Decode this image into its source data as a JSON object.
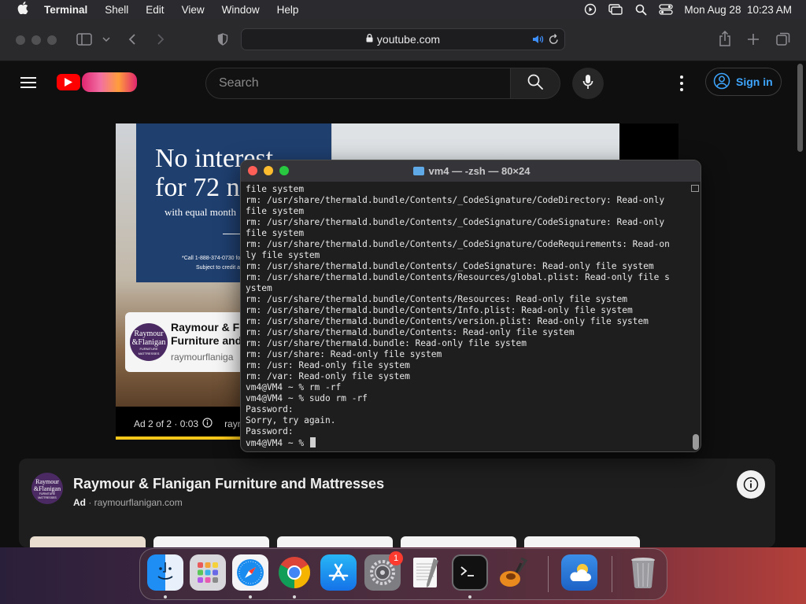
{
  "menubar": {
    "app_name": "Terminal",
    "menus": [
      "Shell",
      "Edit",
      "View",
      "Window",
      "Help"
    ],
    "clock": "Mon Aug 28  10:23 AM"
  },
  "browser": {
    "url": "youtube.com"
  },
  "youtube": {
    "search_placeholder": "Search",
    "sign_in_label": "Sign in",
    "ad": {
      "headline_line1": "No interest",
      "headline_line2": "for 72 n",
      "subline": "with equal month",
      "fine_print_1": "*Call 1-888-374-0730 for financing",
      "fine_print_2": "Subject to credit approval.",
      "card_title_1": "Raymour & Fla",
      "card_title_2": "Furniture and",
      "card_domain": "raymourflaniga",
      "card_logo_lines": [
        "Raymour",
        "&Flanigan",
        "FURNITURE",
        "MATTRESSES"
      ],
      "ad_counter": "Ad 2 of 2 · 0:03",
      "ad_domain_partial": "raym",
      "progress_fraction": 0.222
    },
    "advertiser": {
      "title": "Raymour & Flanigan Furniture and Mattresses",
      "ad_label": "Ad",
      "domain": " · raymourflanigan.com",
      "logo_lines": [
        "Raymour",
        "&Flanigan",
        "FURNITURE",
        "MATTRESSES"
      ]
    }
  },
  "terminal": {
    "title": "vm4 — -zsh — 80×24",
    "lines": [
      "file system",
      "rm: /usr/share/thermald.bundle/Contents/_CodeSignature/CodeDirectory: Read-only",
      "file system",
      "rm: /usr/share/thermald.bundle/Contents/_CodeSignature/CodeSignature: Read-only",
      "file system",
      "rm: /usr/share/thermald.bundle/Contents/_CodeSignature/CodeRequirements: Read-on",
      "ly file system",
      "rm: /usr/share/thermald.bundle/Contents/_CodeSignature: Read-only file system",
      "rm: /usr/share/thermald.bundle/Contents/Resources/global.plist: Read-only file s",
      "ystem",
      "rm: /usr/share/thermald.bundle/Contents/Resources: Read-only file system",
      "rm: /usr/share/thermald.bundle/Contents/Info.plist: Read-only file system",
      "rm: /usr/share/thermald.bundle/Contents/version.plist: Read-only file system",
      "rm: /usr/share/thermald.bundle/Contents: Read-only file system",
      "rm: /usr/share/thermald.bundle: Read-only file system",
      "rm: /usr/share: Read-only file system",
      "rm: /usr: Read-only file system",
      "rm: /var: Read-only file system",
      "vm4@VM4 ~ % rm -rf",
      "vm4@VM4 ~ % sudo rm -rf",
      "Password:",
      "Sorry, try again.",
      "Password:",
      "vm4@VM4 ~ % "
    ]
  },
  "dock": {
    "apps": [
      {
        "name": "finder",
        "running": true
      },
      {
        "name": "launchpad",
        "running": false
      },
      {
        "name": "safari",
        "running": true
      },
      {
        "name": "chrome",
        "running": true
      },
      {
        "name": "app-store",
        "running": false
      },
      {
        "name": "system-settings",
        "running": false,
        "badge": "1"
      },
      {
        "name": "textedit",
        "running": false
      },
      {
        "name": "terminal",
        "running": true
      },
      {
        "name": "garageband",
        "running": false
      },
      {
        "name": "weather",
        "running": false
      },
      {
        "name": "trash",
        "running": false
      }
    ]
  },
  "colors": {
    "yt_red": "#ff0000",
    "signin_blue": "#3ea6ff",
    "ad_progress": "#f7c61b",
    "ad_navy": "#1f3f6f",
    "advertiser_purple": "#4b2a63",
    "tl_close": "#ff5f57",
    "tl_min": "#febc2e",
    "tl_max": "#28c840"
  }
}
